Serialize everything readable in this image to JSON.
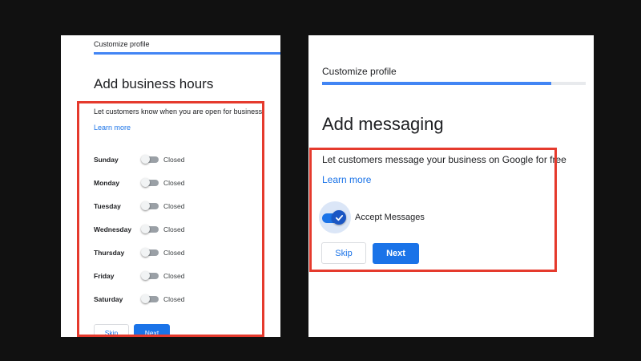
{
  "colors": {
    "background": "#111111",
    "highlight": "#e53a2d",
    "accent": "#1a73e8",
    "progress": "#4285f4"
  },
  "left_panel": {
    "breadcrumb": "Customize profile",
    "progress_fraction": 1.0,
    "title": "Add business hours",
    "description": "Let customers know when you are open for business",
    "learn_more": "Learn more",
    "days": [
      {
        "name": "Sunday",
        "status": "Closed",
        "enabled": false
      },
      {
        "name": "Monday",
        "status": "Closed",
        "enabled": false
      },
      {
        "name": "Tuesday",
        "status": "Closed",
        "enabled": false
      },
      {
        "name": "Wednesday",
        "status": "Closed",
        "enabled": false
      },
      {
        "name": "Thursday",
        "status": "Closed",
        "enabled": false
      },
      {
        "name": "Friday",
        "status": "Closed",
        "enabled": false
      },
      {
        "name": "Saturday",
        "status": "Closed",
        "enabled": false
      }
    ],
    "skip_label": "Skip",
    "next_label": "Next"
  },
  "right_panel": {
    "breadcrumb": "Customize profile",
    "progress_fraction": 0.87,
    "title": "Add messaging",
    "description": "Let customers message your business on Google for free",
    "learn_more": "Learn more",
    "toggle_label": "Accept Messages",
    "toggle_on": true,
    "skip_label": "Skip",
    "next_label": "Next"
  },
  "icons": {
    "toggle_check": "checkmark-icon"
  }
}
